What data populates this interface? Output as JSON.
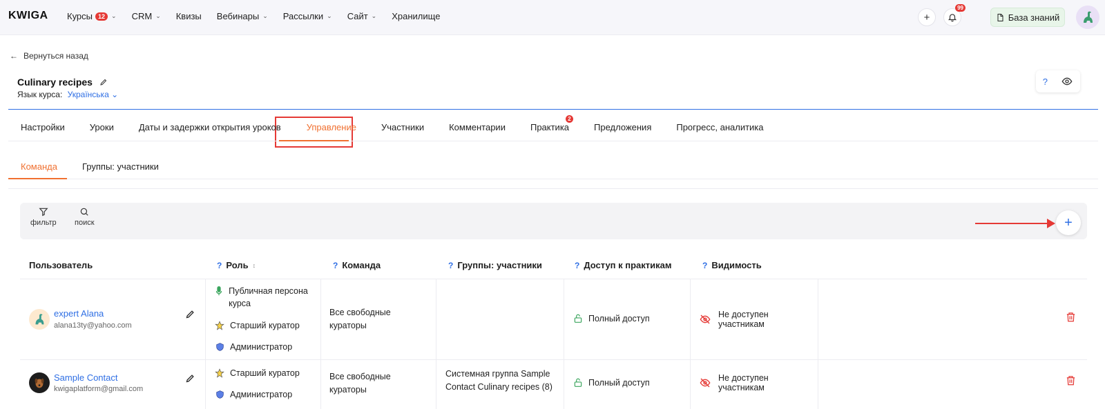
{
  "topbar": {
    "logo": "KWIGA",
    "nav": [
      {
        "label": "Курсы",
        "badge": "12",
        "has_dropdown": true
      },
      {
        "label": "CRM",
        "badge": "",
        "has_dropdown": true
      },
      {
        "label": "Квизы",
        "badge": "",
        "has_dropdown": false
      },
      {
        "label": "Вебинары",
        "badge": "",
        "has_dropdown": true
      },
      {
        "label": "Рассылки",
        "badge": "",
        "has_dropdown": true
      },
      {
        "label": "Сайт",
        "badge": "",
        "has_dropdown": true
      },
      {
        "label": "Хранилище",
        "badge": "",
        "has_dropdown": false
      }
    ],
    "add_icon": "plus-icon",
    "notifications_badge": "99",
    "knowledge_base_label": "База знаний"
  },
  "back_label": "Вернуться назад",
  "course": {
    "title": "Culinary recipes",
    "lang_label": "Язык курса:",
    "lang_value": "Українська"
  },
  "help_icons": {
    "help": "?"
  },
  "tabs": [
    {
      "label": "Настройки",
      "active": false,
      "badge": ""
    },
    {
      "label": "Уроки",
      "active": false,
      "badge": ""
    },
    {
      "label": "Даты и задержки открытия уроков",
      "active": false,
      "badge": ""
    },
    {
      "label": "Управление",
      "active": true,
      "badge": ""
    },
    {
      "label": "Участники",
      "active": false,
      "badge": ""
    },
    {
      "label": "Комментарии",
      "active": false,
      "badge": ""
    },
    {
      "label": "Практика",
      "active": false,
      "badge": "2"
    },
    {
      "label": "Предложения",
      "active": false,
      "badge": ""
    },
    {
      "label": "Прогресс, аналитика",
      "active": false,
      "badge": ""
    }
  ],
  "subtabs": [
    {
      "label": "Команда",
      "active": true
    },
    {
      "label": "Группы: участники",
      "active": false
    }
  ],
  "toolbar": {
    "filter_label": "фильтр",
    "search_label": "поиск"
  },
  "table": {
    "headers": {
      "user": "Пользователь",
      "role": "Роль",
      "team": "Команда",
      "groups": "Группы: участники",
      "practice_access": "Доступ к практикам",
      "visibility": "Видимость",
      "help": "?"
    },
    "rows": [
      {
        "name": "expert Alana",
        "email": "alana13ty@yahoo.com",
        "roles": [
          "Публичная персона курса",
          "Старший куратор",
          "Администратор"
        ],
        "team": "Все свободные кураторы",
        "groups": "",
        "access": "Полный доступ",
        "visibility": "Не доступен участникам"
      },
      {
        "name": "Sample Contact",
        "email": "kwigaplatform@gmail.com",
        "roles": [
          "Старший куратор",
          "Администратор"
        ],
        "team": "Все свободные кураторы",
        "groups": "Системная группа Sample Contact Culinary recipes (8)",
        "access": "Полный доступ",
        "visibility": "Не доступен участникам"
      }
    ]
  },
  "colors": {
    "accent": "#f07030",
    "link": "#2f6fe4",
    "danger": "#e53935"
  }
}
